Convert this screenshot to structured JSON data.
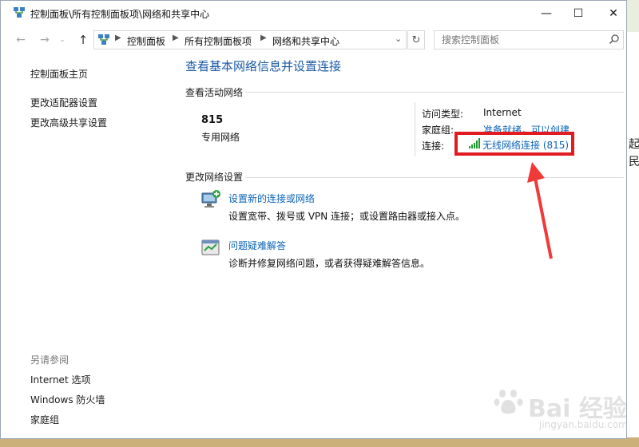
{
  "window": {
    "title": "控制面板\\所有控制面板项\\网络和共享中心",
    "controls": {
      "minimize": "—",
      "maximize": "☐",
      "close": "✕"
    }
  },
  "address": {
    "crumbs": [
      "控制面板",
      "所有控制面板项",
      "网络和共享中心"
    ],
    "search_placeholder": "搜索控制面板"
  },
  "sidebar": {
    "home": "控制面板主页",
    "items": [
      "更改适配器设置",
      "更改高级共享设置"
    ],
    "see_also_heading": "另请参阅",
    "see_also": [
      "Internet 选项",
      "Windows 防火墙",
      "家庭组"
    ]
  },
  "main": {
    "title": "查看基本网络信息并设置连接",
    "active_networks_heading": "查看活动网络",
    "network": {
      "name": "815",
      "type": "专用网络",
      "access_type_label": "访问类型:",
      "access_type_value": "Internet",
      "homegroup_label": "家庭组:",
      "homegroup_value": "准备就绪，可以创建",
      "connections_label": "连接:",
      "connection_link": "无线网络连接 (815)"
    },
    "change_settings_heading": "更改网络设置",
    "tasks": [
      {
        "title": "设置新的连接或网络",
        "desc": "设置宽带、拨号或 VPN 连接；或设置路由器或接入点。"
      },
      {
        "title": "问题疑难解答",
        "desc": "诊断并修复网络问题，或者获得疑难解答信息。"
      }
    ]
  },
  "desktop": {
    "side_text_1": "起",
    "side_text_2": "民"
  },
  "watermark": {
    "brand": "Bai 经验",
    "url": "jingyan.baidu.com"
  },
  "colors": {
    "link": "#0c64b6",
    "title_blue": "#1b5aa5",
    "highlight": "#e11b22"
  }
}
